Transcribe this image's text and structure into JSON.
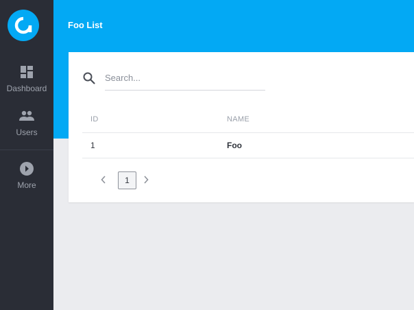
{
  "app": {
    "accent_color": "#03a9f4",
    "sidebar_color": "#2a2d36",
    "logo_icon": "app-logo-icon"
  },
  "sidebar": {
    "items": [
      {
        "label": "Dashboard",
        "icon": "dashboard-icon"
      },
      {
        "label": "Users",
        "icon": "users-icon"
      },
      {
        "label": "More",
        "icon": "more-icon"
      }
    ]
  },
  "header": {
    "title": "Foo List"
  },
  "search": {
    "placeholder": "Search...",
    "value": ""
  },
  "table": {
    "columns": [
      "ID",
      "NAME"
    ],
    "rows": [
      {
        "id": "1",
        "name": "Foo"
      }
    ]
  },
  "pagination": {
    "current_page": "1",
    "prev_icon": "chevron-left-icon",
    "next_icon": "chevron-right-icon"
  }
}
